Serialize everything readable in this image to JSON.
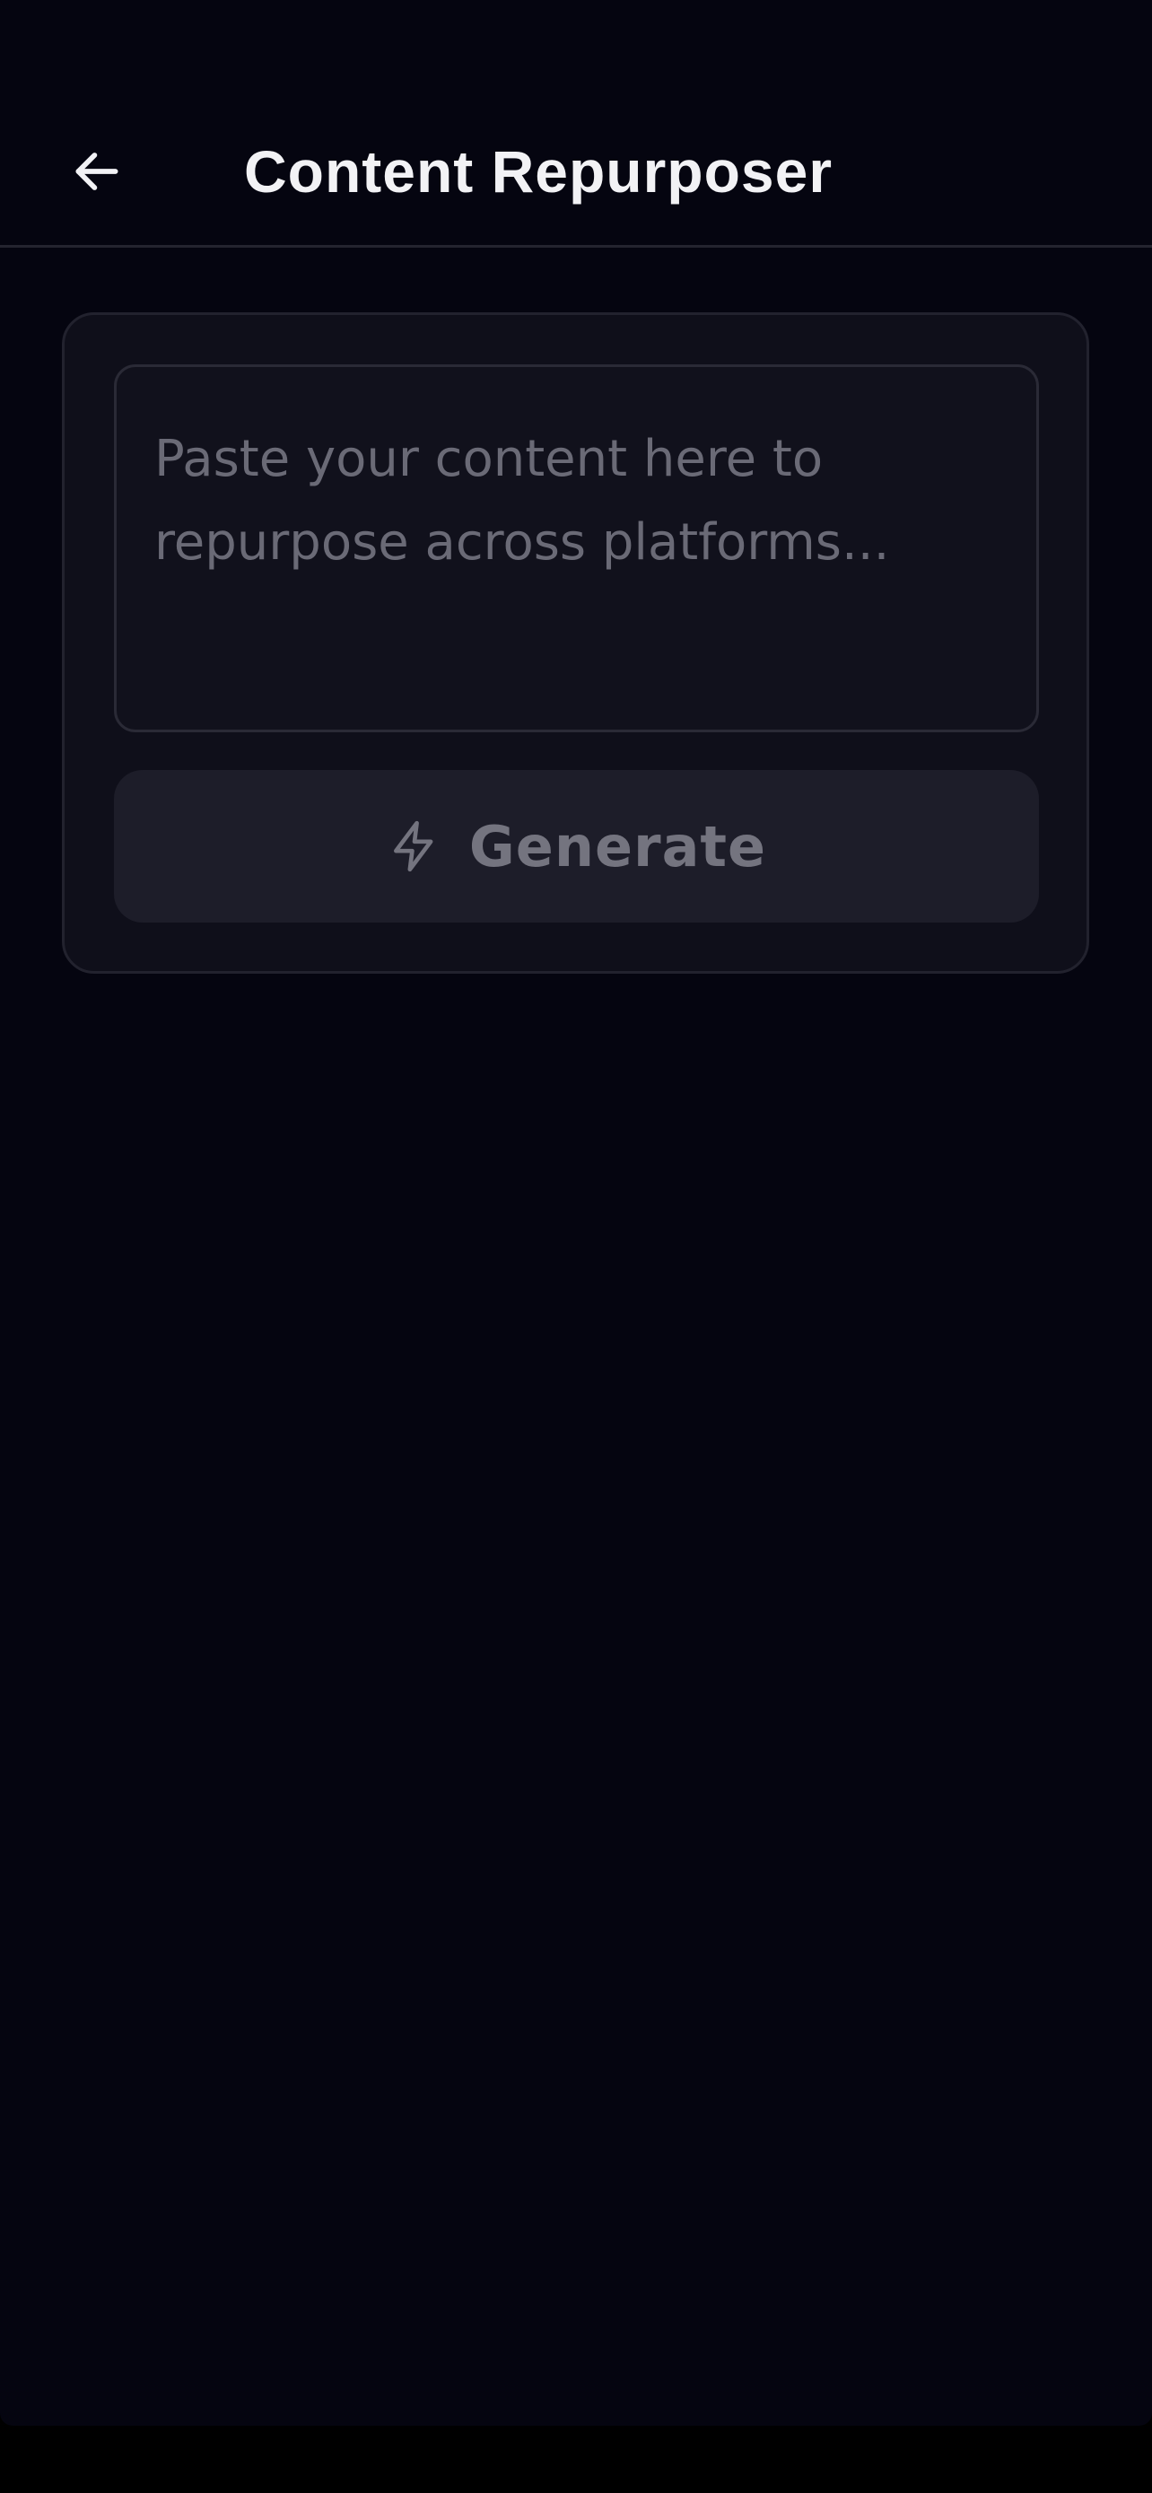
{
  "header": {
    "back_icon": "arrow-left-icon",
    "title": "Content Repurposer"
  },
  "form": {
    "content_input": {
      "placeholder": "Paste your content here to repurpose across platforms...",
      "value": ""
    },
    "generate_button": {
      "icon": "lightning-icon",
      "label": "Generate"
    }
  },
  "colors": {
    "background": "#050510",
    "card": "#0f0f1a",
    "input": "#11111c",
    "button_disabled": "#1d1d29",
    "title_text": "#f2f2f5",
    "muted_text": "#74747f"
  }
}
